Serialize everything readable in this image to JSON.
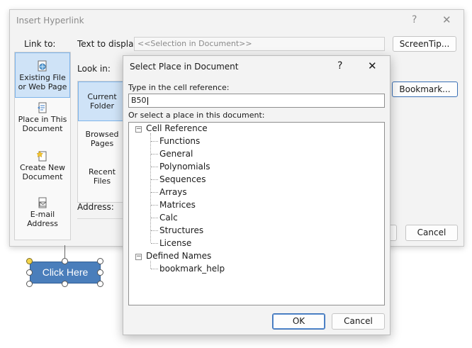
{
  "main_dialog": {
    "title": "Insert Hyperlink",
    "help_glyph": "?",
    "close_glyph": "✕",
    "link_to_label": "Link to:",
    "text_to_display_label": "Text to display:",
    "text_to_display_value": "<<Selection in Document>>",
    "screentip_button": "ScreenTip...",
    "look_in_label": "Look in:",
    "bookmark_button": "Bookmark...",
    "address_label": "Address:",
    "cancel_button": "Cancel",
    "link_to_items": [
      {
        "line1": "Existing File",
        "line2": "or Web Page",
        "icon": "globe-file-icon",
        "selected": true
      },
      {
        "line1": "Place in This",
        "line2": "Document",
        "icon": "document-place-icon",
        "selected": false
      },
      {
        "line1": "Create New",
        "line2": "Document",
        "icon": "new-document-icon",
        "selected": false
      },
      {
        "line1": "E-mail",
        "line2": "Address",
        "icon": "email-icon",
        "selected": false
      }
    ],
    "look_in_items": [
      {
        "line1": "Current",
        "line2": "Folder",
        "selected": true
      },
      {
        "line1": "Browsed",
        "line2": "Pages",
        "selected": false
      },
      {
        "line1": "Recent",
        "line2": "Files",
        "selected": false
      }
    ]
  },
  "front_dialog": {
    "title": "Select Place in Document",
    "help_glyph": "?",
    "close_glyph": "✕",
    "cell_ref_label": "Type in the cell reference:",
    "cell_ref_value": "B50",
    "place_label": "Or select a place in this document:",
    "tree": {
      "root1": "Cell Reference",
      "root1_children": [
        "Functions",
        "General",
        "Polynomials",
        "Sequences",
        "Arrays",
        "Matrices",
        "Calc",
        "Structures",
        "License"
      ],
      "root2": "Defined Names",
      "root2_children": [
        "bookmark_help"
      ]
    },
    "ok_button": "OK",
    "cancel_button": "Cancel"
  },
  "shape": {
    "label": "Click Here",
    "fill": "#4a7ebb",
    "border": "#2f5d94"
  }
}
